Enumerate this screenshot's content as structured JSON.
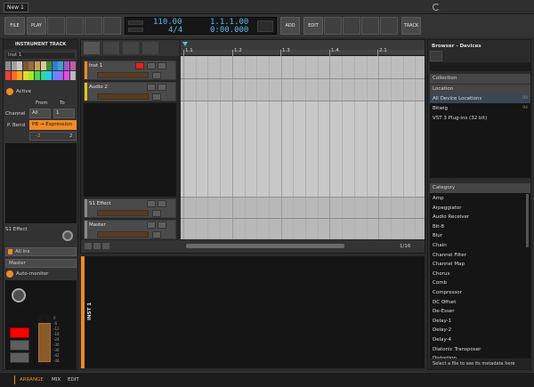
{
  "project_tab": "New 1",
  "toolbar": {
    "file": "FILE",
    "play": "PLAY",
    "add": "ADD",
    "edit": "EDIT",
    "track": "TRACK"
  },
  "transport": {
    "tempo": "110.00",
    "signature": "4/4",
    "position": "1.1.1.00",
    "time": "0:00.000"
  },
  "inspector": {
    "title": "INSTRUMENT TRACK",
    "track_name": "Inst 1",
    "active": "Active",
    "from": "From",
    "to": "To",
    "channel_label": "Channel",
    "channel_from": "All",
    "channel_to": "1",
    "pbend_label": "P. Bend",
    "pbend_value": "PB → Expression",
    "range_min": "-2",
    "range_max": "2",
    "effect": "S1 Effect",
    "all_ins": "All ins",
    "master": "Master",
    "auto_monitor": "Auto-monitor",
    "vu_scale": [
      "0",
      "-6",
      "-12",
      "-18",
      "-24",
      "-30",
      "-36",
      "-42",
      "-48"
    ]
  },
  "arranger": {
    "tracks": [
      {
        "name": "Inst 1",
        "color": "#f08a24"
      },
      {
        "name": "Audio 2",
        "color": "#e8c21a"
      },
      {
        "name": "S1 Effect",
        "color": "#888888"
      },
      {
        "name": "Master",
        "color": "#888888"
      }
    ],
    "ruler": [
      "1.1",
      "1.2",
      "1.3",
      "1.4",
      "2.1"
    ],
    "zoom": "1/16",
    "editor_track": "INST 1"
  },
  "browser": {
    "title": "Browser - Devices",
    "collection": "Collection",
    "location": "Location",
    "locations": [
      {
        "name": "All Device Locations",
        "count": "94"
      },
      {
        "name": "Bitwig",
        "count": "94"
      },
      {
        "name": "VST 3 Plug-ins (32 bit)",
        "count": ""
      }
    ],
    "category": "Category",
    "categories": [
      "Amp",
      "Arpeggiator",
      "Audio Receiver",
      "Bit-8",
      "Blur",
      "Chain",
      "Channel Filter",
      "Channel Map",
      "Chorus",
      "Comb",
      "Compressor",
      "DC Offset",
      "De-Esser",
      "Delay-1",
      "Delay-2",
      "Delay-4",
      "Diatonic Transposer",
      "Distortion"
    ],
    "footer": "Select a file to see its metadata here"
  },
  "bottom": {
    "arrange": "ARRANGE",
    "mix": "MIX",
    "edit": "EDIT"
  },
  "colors": {
    "accent": "#f08a24",
    "lcd": "#5ab6ee",
    "record": "#ff0000"
  },
  "palette": [
    "#8a8a8a",
    "#a0a0a0",
    "#c8c8c8",
    "#7a5a3a",
    "#9b6d3d",
    "#c8a064",
    "#e0c88a",
    "#3a8f3a",
    "#2e7fd0",
    "#3aa0d8",
    "#9a5ac8",
    "#c85aa8",
    "#ff3a3a",
    "#ff6a2a",
    "#ffa02a",
    "#e8d82a",
    "#a8e82a",
    "#4ad84a",
    "#2ad8a0",
    "#2ac8e8",
    "#5a8aff",
    "#9a6aff",
    "#e84ae8",
    "#bbbbbb"
  ]
}
